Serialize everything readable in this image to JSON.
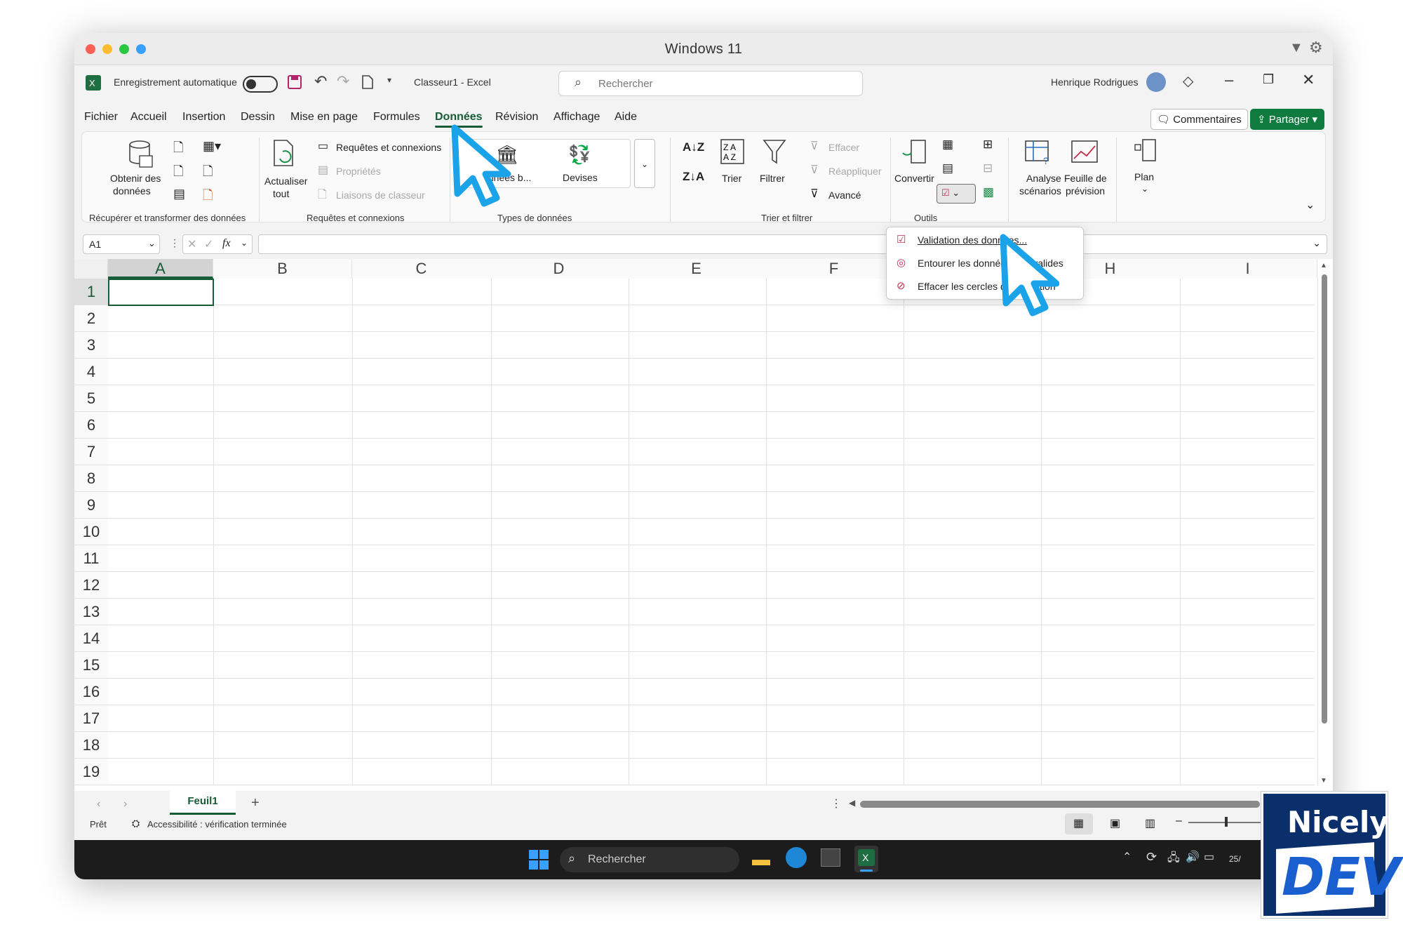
{
  "window": {
    "title": "Windows 11",
    "traffic_colors": [
      "#ff5f57",
      "#febc2e",
      "#28c840",
      "#3aa0ff"
    ]
  },
  "qat": {
    "autosave_label": "Enregistrement automatique",
    "doc_title": "Classeur1  -  Excel",
    "search_placeholder": "Rechercher",
    "user_name": "Henrique Rodrigues"
  },
  "menu": {
    "items": [
      "Fichier",
      "Accueil",
      "Insertion",
      "Dessin",
      "Mise en page",
      "Formules",
      "Données",
      "Révision",
      "Affichage",
      "Aide"
    ],
    "active": "Données",
    "comments": "Commentaires",
    "share": "Partager"
  },
  "ribbon": {
    "get_data": {
      "label1": "Obtenir des",
      "label2": "données",
      "group": "Récupérer et transformer des données"
    },
    "queries": {
      "refresh1": "Actualiser",
      "refresh2": "tout",
      "queries_conn": "Requêtes et connexions",
      "props": "Propriétés",
      "links": "Liaisons de classeur",
      "group": "Requêtes et connexions"
    },
    "types": {
      "stocks": "Données b...",
      "currencies": "Devises",
      "group": "Types de données"
    },
    "sort": {
      "sort": "Trier",
      "filter": "Filtrer",
      "clear": "Effacer",
      "reapply": "Réappliquer",
      "advanced": "Avancé",
      "group": "Trier et filtrer"
    },
    "tools": {
      "convert": "Convertir",
      "group": "Outils"
    },
    "forecast": {
      "whatif1": "Analyse",
      "whatif2": "scénarios",
      "sheet1": "Feuille de",
      "sheet2": "prévision",
      "outline": "Plan"
    }
  },
  "dropdown": {
    "items": [
      "Validation des données...",
      "Entourer les données non valides",
      "Effacer les cercles de validation"
    ]
  },
  "formula": {
    "cell_ref": "A1",
    "fx": "fx",
    "value": ""
  },
  "grid": {
    "columns": [
      "A",
      "B",
      "C",
      "D",
      "E",
      "F",
      "G",
      "H",
      "I"
    ],
    "rows": [
      "1",
      "2",
      "3",
      "4",
      "5",
      "6",
      "7",
      "8",
      "9",
      "10",
      "11",
      "12",
      "13",
      "14",
      "15",
      "16",
      "17",
      "18",
      "19"
    ],
    "active_cell": "A1"
  },
  "tabs": {
    "sheet": "Feuil1",
    "add": "+"
  },
  "status": {
    "ready": "Prêt",
    "accessibility": "Accessibilité : vérification terminée"
  },
  "taskbar": {
    "search": "Rechercher",
    "date": "25/"
  },
  "badge": {
    "line1": "Nicely",
    "line2": "DEV"
  },
  "colors": {
    "excel_green": "#185c37",
    "share_green": "#0f7b3f",
    "cursor_blue": "#1aa3e8"
  }
}
